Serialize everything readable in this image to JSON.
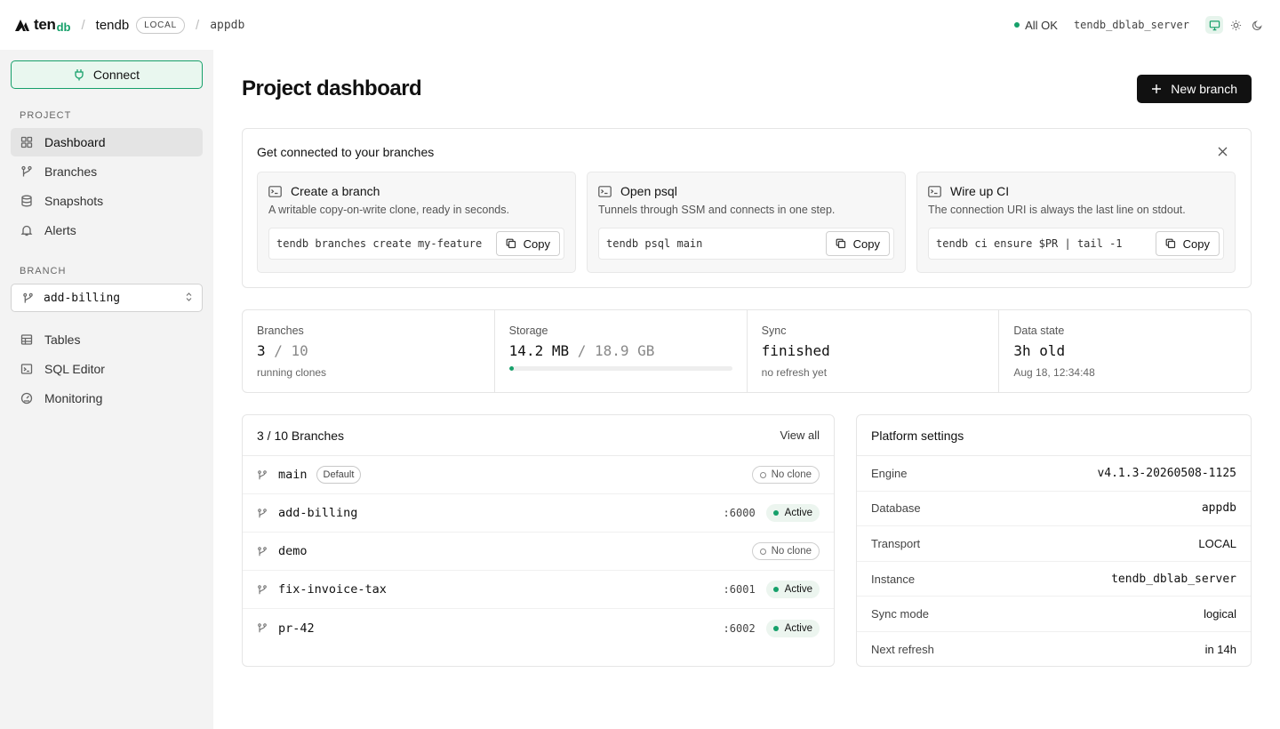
{
  "topbar": {
    "logo_text": "ten",
    "logo_suffix": "db",
    "project": "tendb",
    "env_badge": "LOCAL",
    "database": "appdb",
    "status": "All OK",
    "server": "tendb_dblab_server",
    "theme_icons": [
      "monitor-icon",
      "sun-icon",
      "moon-icon"
    ]
  },
  "sidebar": {
    "connect_label": "Connect",
    "project_section": "PROJECT",
    "project_items": [
      {
        "label": "Dashboard",
        "icon": "grid-icon",
        "active": true
      },
      {
        "label": "Branches",
        "icon": "git-branch-icon"
      },
      {
        "label": "Snapshots",
        "icon": "database-icon"
      },
      {
        "label": "Alerts",
        "icon": "bell-icon"
      }
    ],
    "branch_section": "BRANCH",
    "branch_selected": "add-billing",
    "branch_items": [
      {
        "label": "Tables",
        "icon": "table-icon"
      },
      {
        "label": "SQL Editor",
        "icon": "terminal-icon"
      },
      {
        "label": "Monitoring",
        "icon": "gauge-icon"
      }
    ]
  },
  "main": {
    "title": "Project dashboard",
    "new_branch_label": "New branch",
    "connect_card": {
      "title": "Get connected to your branches",
      "tiles": [
        {
          "title": "Create a branch",
          "desc": "A writable copy-on-write clone, ready in seconds.",
          "command": "tendb branches create my-feature",
          "copy": "Copy"
        },
        {
          "title": "Open psql",
          "desc": "Tunnels through SSM and connects in one step.",
          "command": "tendb psql main",
          "copy": "Copy"
        },
        {
          "title": "Wire up CI",
          "desc": "The connection URI is always the last line on stdout.",
          "command": "tendb ci ensure $PR | tail -1",
          "copy": "Copy"
        }
      ]
    },
    "stats": {
      "branches": {
        "label": "Branches",
        "value": "3",
        "total": " / 10",
        "sub": "running clones"
      },
      "storage": {
        "label": "Storage",
        "value": "14.2 MB",
        "total": " / 18.9 GB",
        "progress_fraction": 0.0008
      },
      "sync": {
        "label": "Sync",
        "value": "finished",
        "sub": "no refresh yet"
      },
      "data_state": {
        "label": "Data state",
        "value": "3h old",
        "sub": "Aug 18, 12:34:48"
      }
    },
    "branches_card": {
      "title": "3 / 10 Branches",
      "view_all": "View all",
      "rows": [
        {
          "name": "main",
          "default": "Default",
          "port": "",
          "status": "No clone",
          "active": false
        },
        {
          "name": "add-billing",
          "default": "",
          "port": ":6000",
          "status": "Active",
          "active": true
        },
        {
          "name": "demo",
          "default": "",
          "port": "",
          "status": "No clone",
          "active": false
        },
        {
          "name": "fix-invoice-tax",
          "default": "",
          "port": ":6001",
          "status": "Active",
          "active": true
        },
        {
          "name": "pr-42",
          "default": "",
          "port": ":6002",
          "status": "Active",
          "active": true
        }
      ]
    },
    "settings_card": {
      "title": "Platform settings",
      "rows": [
        {
          "key": "Engine",
          "value": "v4.1.3-20260508-1125",
          "mono": true
        },
        {
          "key": "Database",
          "value": "appdb",
          "mono": true
        },
        {
          "key": "Transport",
          "value": "LOCAL",
          "mono": false
        },
        {
          "key": "Instance",
          "value": "tendb_dblab_server",
          "mono": true
        },
        {
          "key": "Sync mode",
          "value": "logical",
          "mono": false
        },
        {
          "key": "Next refresh",
          "value": "in 14h",
          "mono": false
        }
      ]
    }
  },
  "colors": {
    "accent": "#16a06a",
    "primary_button": "#111111"
  }
}
